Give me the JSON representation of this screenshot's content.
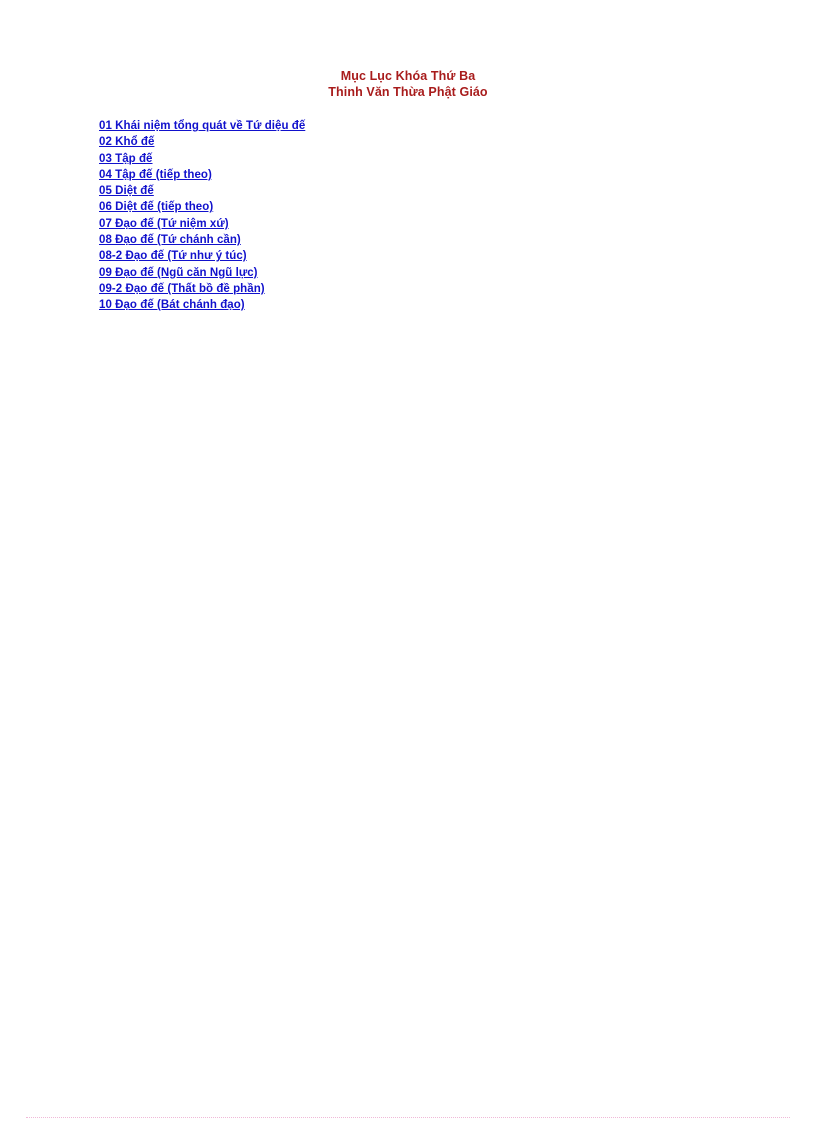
{
  "document": {
    "title_lines": [
      "Mục Lục Khóa Thứ Ba",
      "Thinh Văn Thừa Phật Giáo"
    ],
    "title_color": "#a81c1c",
    "link_color": "#1111cc",
    "rule_color": "#f0b9d8",
    "background_color": "#ffffff",
    "toc": [
      {
        "label": "01 Khái niệm tổng quát về Tứ diệu đế"
      },
      {
        "label": "02 Khổ đế"
      },
      {
        "label": "03 Tập đế"
      },
      {
        "label": "04 Tập đế (tiếp theo)"
      },
      {
        "label": "05 Diệt đế"
      },
      {
        "label": "06 Diệt đế (tiếp theo)"
      },
      {
        "label": "07 Đạo đế (Tứ niệm xứ)"
      },
      {
        "label": "08 Đạo đế (Tứ chánh cần)"
      },
      {
        "label": "08-2 Đạo đế (Tứ như ý túc)"
      },
      {
        "label": "09 Đạo đế (Ngũ căn Ngũ lực)"
      },
      {
        "label": "09-2 Đạo đế (Thất bồ đề phần)"
      },
      {
        "label": "10 Đạo đế (Bát chánh đạo)"
      }
    ]
  }
}
